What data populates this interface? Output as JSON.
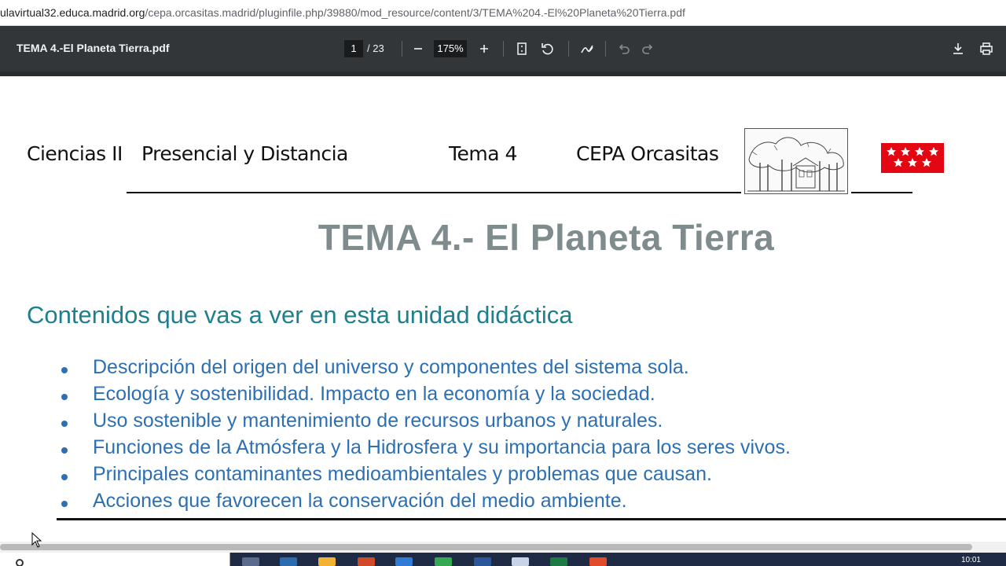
{
  "browser": {
    "url_domain": "ulavirtual32.educa.madrid.org",
    "url_path": "/cepa.orcasitas.madrid/pluginfile.php/39880/mod_resource/content/3/TEMA%204.-El%20Planeta%20Tierra.pdf"
  },
  "pdf_toolbar": {
    "file_title": "TEMA 4.-El Planeta Tierra.pdf",
    "page_current": "1",
    "page_total": "/ 23",
    "zoom": "175%"
  },
  "document": {
    "header": {
      "course": "Ciencias II",
      "mode": "Presencial y Distancia",
      "tema": "Tema 4",
      "school": "CEPA Orcasitas"
    },
    "title": "TEMA 4.- El Planeta Tierra",
    "subtitle": "Contenidos que vas a ver en esta unidad didáctica",
    "bullets": [
      "Descripción del origen del universo y componentes del sistema sola.",
      "Ecología y sostenibilidad. Impacto en la economía y la sociedad.",
      "Uso sostenible y mantenimiento de recursos urbanos y naturales.",
      "Funciones de la Atmósfera y la Hidrosfera y su importancia para los seres vivos.",
      "Principales contaminantes medioambientales y problemas que causan.",
      "Acciones que favorecen la conservación del medio ambiente."
    ]
  },
  "taskbar": {
    "clock": "10:01"
  },
  "colors": {
    "toolbar_bg": "#323639",
    "title_gray": "#7f8c8d",
    "subtitle_teal": "#1e7f8e",
    "bullet_blue": "#2d6fb3",
    "flag_red": "#e30613"
  }
}
